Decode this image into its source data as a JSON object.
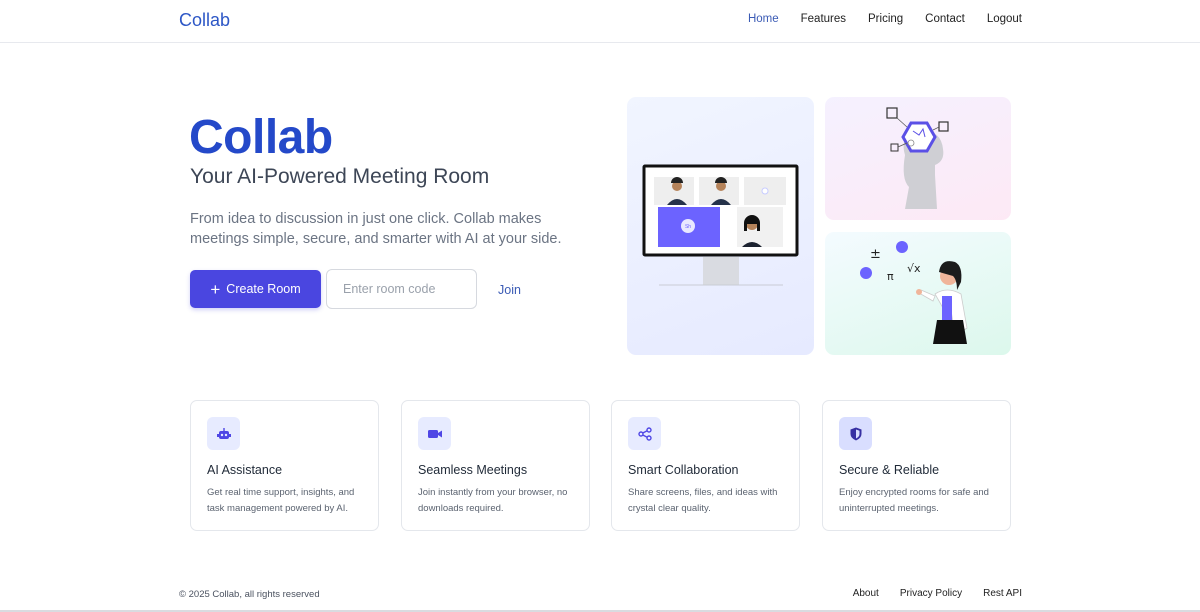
{
  "nav": {
    "brand": "Collab",
    "links": [
      "Home",
      "Features",
      "Pricing",
      "Contact",
      "Logout"
    ],
    "active": "Home"
  },
  "hero": {
    "title": "Collab",
    "subtitle": "Your AI-Powered Meeting Room",
    "description": "From idea to discussion in just one click. Collab makes meetings simple, secure, and smarter with AI at your side.",
    "create_button": "Create Room",
    "room_code_placeholder": "Enter room code",
    "join_label": "Join"
  },
  "illustrations": {
    "avatar_label": "Sh",
    "math_symbols": [
      "±",
      "π",
      "√x"
    ]
  },
  "features": [
    {
      "icon": "robot-icon",
      "title": "AI Assistance",
      "description": "Get real time support, insights, and task management powered by AI."
    },
    {
      "icon": "video-camera-icon",
      "title": "Seamless Meetings",
      "description": "Join instantly from your browser, no downloads required."
    },
    {
      "icon": "share-icon",
      "title": "Smart Collaboration",
      "description": "Share screens, files, and ideas with crystal clear quality."
    },
    {
      "icon": "shield-icon",
      "title": "Secure & Reliable",
      "description": "Enjoy encrypted rooms for safe and uninterrupted meetings."
    }
  ],
  "footer": {
    "copyright": "© 2025 Collab, all rights reserved",
    "links": [
      "About",
      "Privacy Policy",
      "Rest API"
    ]
  },
  "colors": {
    "brand": "#2449c9",
    "primary_button": "#4a46e0",
    "icon_accent": "#4f46e5"
  }
}
